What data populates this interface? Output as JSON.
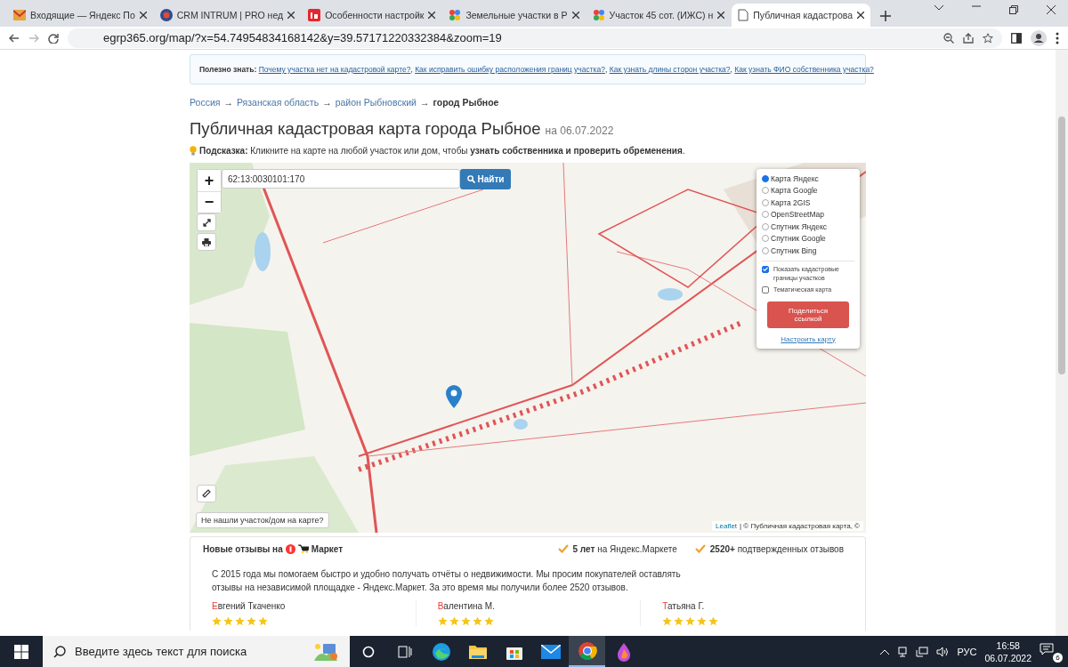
{
  "browser": {
    "tabs": [
      {
        "title": "Входящие — Яндекс По",
        "kind": "mail",
        "selected": false
      },
      {
        "title": "CRM INTRUM | PRO нед",
        "kind": "crm",
        "selected": false
      },
      {
        "title": "Особенности настройк",
        "kind": "in",
        "selected": false
      },
      {
        "title": "Земельные участки в Р",
        "kind": "dots",
        "selected": false
      },
      {
        "title": "Участок 45 сот. (ИЖС) н",
        "kind": "dots",
        "selected": false
      },
      {
        "title": "Публичная кадастрова",
        "kind": "doc",
        "selected": true
      }
    ],
    "address": "egrp365.org/map/?x=54.74954834168142&y=39.57171220332384&zoom=19"
  },
  "info_box": {
    "label": "Полезно знать:",
    "delimiter": ", ",
    "links": [
      "Почему участка нет на кадастровой карте?",
      "Как исправить ошибку расположения границ участка?",
      "Как узнать длины сторон участка?",
      "Как узнать ФИО собственника участка?"
    ]
  },
  "breadcrumb": [
    {
      "label": "Россия",
      "kind": "link"
    },
    {
      "label": "→",
      "kind": "separator"
    },
    {
      "label": "Рязанская область",
      "kind": "link"
    },
    {
      "label": "→",
      "kind": "separator"
    },
    {
      "label": "район Рыбновский",
      "kind": "link"
    },
    {
      "label": "→",
      "kind": "separator"
    },
    {
      "label": "город Рыбное",
      "kind": "current"
    }
  ],
  "title": "Публичная кадастровая карта города Рыбное",
  "date": "на 06.07.2022",
  "hint": "**Подсказка:** Кликните на карте на любой участок или дом, чтобы **узнать собственника и проверить обременения**.",
  "map": {
    "kind": "picture",
    "zoom_in": "+",
    "zoom_out": "−",
    "search_value": "62:13:0030101:170",
    "search_button": "Найти",
    "layers": [
      {
        "label": "Карта Яндекс",
        "selected": true
      },
      {
        "label": "Карта Google",
        "selected": false
      },
      {
        "label": "Карта 2GIS",
        "selected": false
      },
      {
        "label": "OpenStreetMap",
        "selected": false
      },
      {
        "label": "Спутник Яндекс",
        "selected": false
      },
      {
        "label": "Спутник Google",
        "selected": false
      },
      {
        "label": "Спутник Bing",
        "selected": false
      }
    ],
    "options": [
      {
        "label": "Показать кадастровые границы участков",
        "checked": true
      },
      {
        "label": "Тематическая карта",
        "checked": false
      }
    ],
    "share_button": "Поделиться ссылкой",
    "settings_link": "Настроить карту",
    "not_found_button": "Не нашли участок/дом на карте?",
    "attribution_link": "Leaflet",
    "attribution": "| © Публичная кадастровая карта, ©"
  },
  "reviews": {
    "heading": "Новые отзывы на",
    "brand": "Маркет",
    "badges": [
      "**5 лет** на Яндекс.Маркете",
      "**2520+** подтвержденных отзывов"
    ],
    "intro": "С 2015 года мы помогаем быстро и удобно получать отчёты о недвижимости. Мы просим покупателей оставлять отзывы на независимой площадке - Яндекс.Маркет. За это время мы получили более 2520 отзывов.",
    "authors": [
      {
        "name": "Евгений Ткаченко",
        "stars": 5
      },
      {
        "name": "Валентина М.",
        "stars": 5
      },
      {
        "name": "Татьяна Г.",
        "stars": 5
      }
    ]
  },
  "taskbar": {
    "search_placeholder": "Введите здесь текст для поиска",
    "pinned": [
      {
        "kind": "taskview",
        "selected": false
      },
      {
        "kind": "edge",
        "selected": false
      },
      {
        "kind": "folder",
        "selected": false
      },
      {
        "kind": "store",
        "selected": false
      },
      {
        "kind": "mail",
        "selected": false
      },
      {
        "kind": "chrome",
        "selected": true
      },
      {
        "kind": "drop",
        "selected": false
      }
    ],
    "language": "РУС",
    "time": "16:58",
    "date": "06.07.2022",
    "notifications": "6"
  }
}
